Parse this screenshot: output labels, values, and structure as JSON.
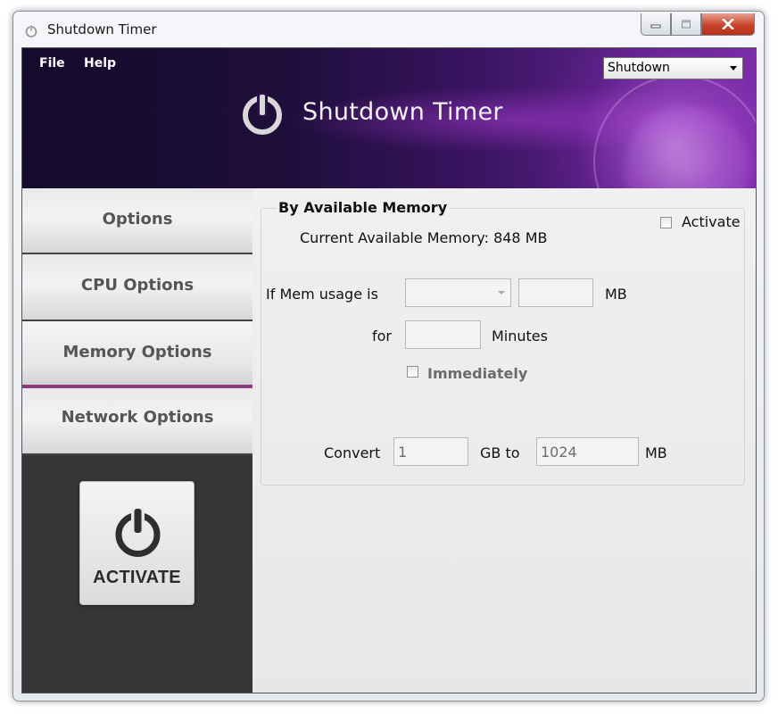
{
  "window": {
    "title": "Shutdown Timer",
    "icons": {
      "app": "power-icon",
      "minimize": "minimize-icon",
      "maximize": "maximize-icon",
      "close": "close-icon"
    }
  },
  "menu": {
    "file": "File",
    "help": "Help"
  },
  "header": {
    "app_name": "Shutdown Timer",
    "action_select": {
      "value": "Shutdown"
    },
    "logo_icon": "power-icon"
  },
  "sidebar": {
    "items": [
      {
        "label": "Options"
      },
      {
        "label": "CPU Options"
      },
      {
        "label": "Memory Options",
        "active": true
      },
      {
        "label": "Network Options"
      }
    ],
    "activate_button": {
      "label": "ACTIVATE",
      "icon": "power-icon"
    }
  },
  "panel": {
    "title": "By Available Memory",
    "activate_label": "Activate",
    "activate_checked": false,
    "current_memory": "Current Available Memory: 848 MB",
    "mem_usage_label": "If Mem usage is",
    "mem_operator_value": "",
    "mem_value": "",
    "mem_unit": "MB",
    "for_label": "for",
    "minutes_value": "",
    "minutes_label": "Minutes",
    "immediately_label": "Immediately",
    "immediately_checked": false,
    "convert": {
      "label": "Convert",
      "gb_value": "1",
      "gb_to_label": "GB to",
      "mb_value": "1024",
      "mb_label": "MB"
    }
  },
  "colors": {
    "header_dark": "#150b2c",
    "header_purple": "#7a2da8",
    "sidebar_bg": "#363636",
    "active_accent": "#8a3b7e",
    "close_button": "#c8432a"
  }
}
